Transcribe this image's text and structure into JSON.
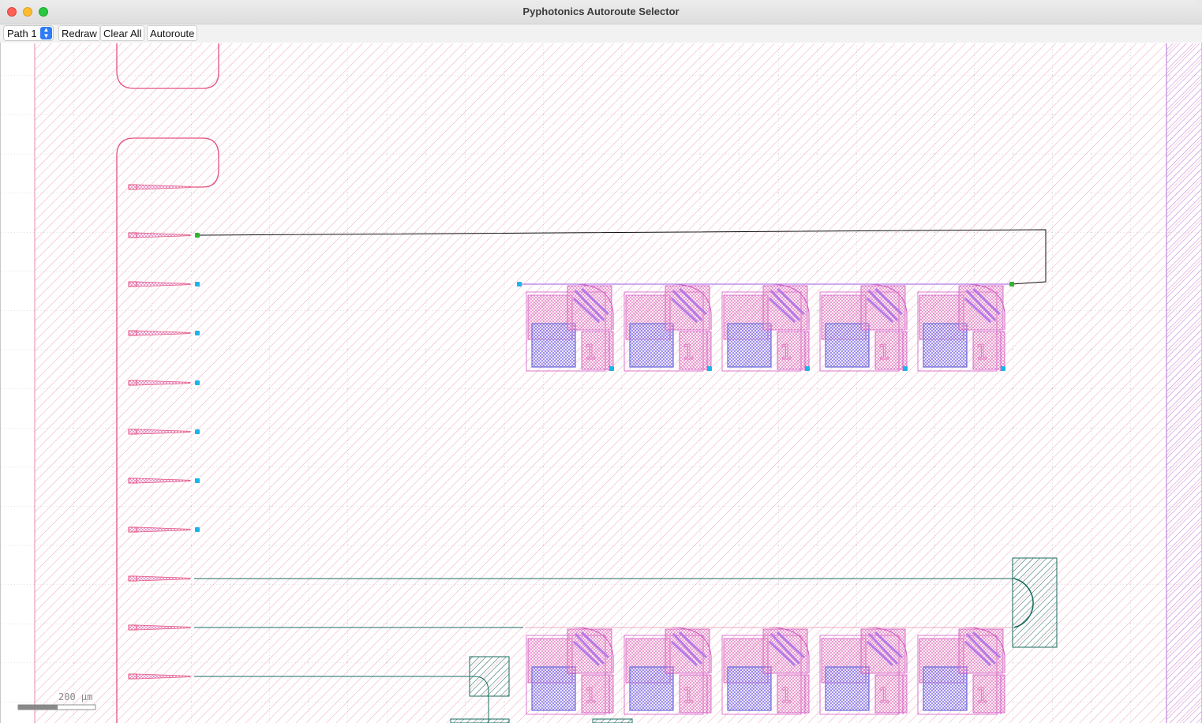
{
  "window": {
    "title": "Pyphotonics Autoroute Selector"
  },
  "toolbar": {
    "path_select": {
      "value": "Path 1"
    },
    "redraw_label": "Redraw",
    "clear_all_label": "Clear All",
    "autoroute_label": "Autoroute"
  },
  "layout_view": {
    "scale_bar_label": "200 µm",
    "device_label": "1",
    "colors": {
      "cladding": "#e98aa8",
      "waveguide": "#e4507c",
      "device_outline": "#d257c4",
      "device_fill": "#b57be8",
      "pad": "#6f6cdb",
      "port_available": "#1ab5e8",
      "port_selected": "#2fb52f",
      "route_path": "#111111",
      "routed_waveguide": "#1a6b5c"
    },
    "icons": {
      "select_arrows": "updown-chevron-icon",
      "close": "close-icon",
      "minimize": "minimize-icon",
      "maximize": "maximize-icon"
    }
  }
}
